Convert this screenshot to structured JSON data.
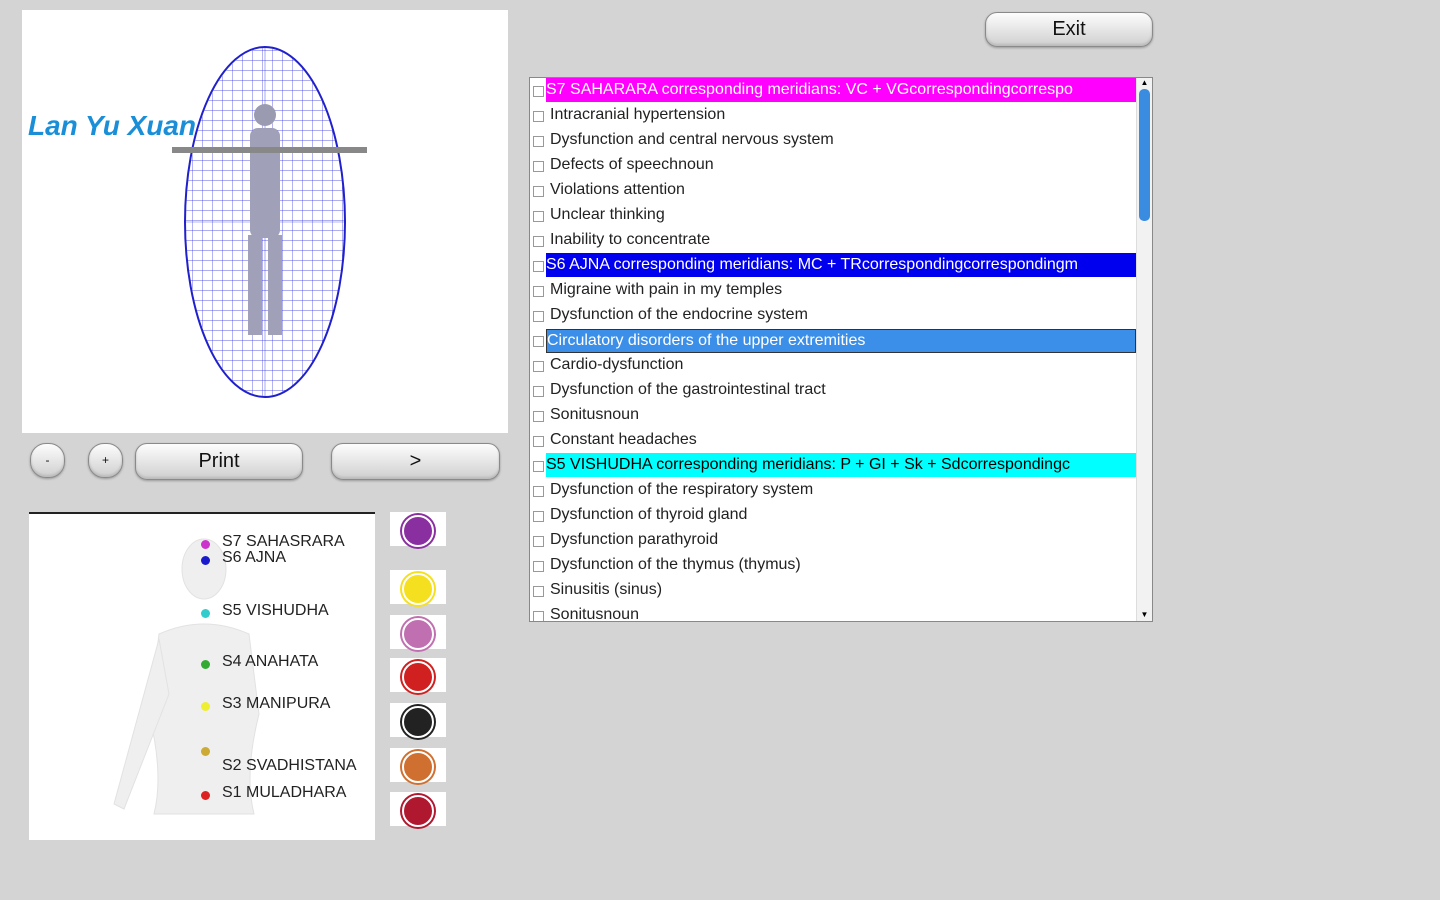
{
  "viewer": {
    "logo": "Lan Yu Xuan"
  },
  "buttons": {
    "zoom_out": "-",
    "zoom_in": "+",
    "print": "Print",
    "next": ">",
    "exit": "Exit"
  },
  "list": {
    "items": [
      {
        "label": "S7 SAHARARA corresponding meridians: VC + VGcorrespondingcorrespo",
        "type": "header",
        "color": "#ff00ff",
        "text_color": "#ffffff"
      },
      {
        "label": "Intracranial hypertension"
      },
      {
        "label": "Dysfunction and central nervous system"
      },
      {
        "label": "Defects of speechnoun"
      },
      {
        "label": "Violations attention"
      },
      {
        "label": "Unclear thinking"
      },
      {
        "label": "Inability to concentrate"
      },
      {
        "label": "S6 AJNA corresponding meridians: MC + TRcorrespondingcorrespondingm",
        "type": "header",
        "color": "#0000ee",
        "text_color": "#ffffff"
      },
      {
        "label": "Migraine with pain in my temples"
      },
      {
        "label": "Dysfunction of the endocrine system"
      },
      {
        "label": "Circulatory disorders of the upper extremities",
        "type": "selected"
      },
      {
        "label": "Cardio-dysfunction"
      },
      {
        "label": "Dysfunction of the gastrointestinal tract"
      },
      {
        "label": "Sonitusnoun"
      },
      {
        "label": "Constant headaches"
      },
      {
        "label": "S5 VISHUDHA corresponding meridians: P + GI + Sk + Sdcorrespondingc",
        "type": "header",
        "color": "#00ffff",
        "text_color": "#000000"
      },
      {
        "label": "Dysfunction of the respiratory system"
      },
      {
        "label": "Dysfunction of thyroid gland"
      },
      {
        "label": "Dysfunction parathyroid"
      },
      {
        "label": "Dysfunction of the thymus (thymus)"
      },
      {
        "label": "Sinusitis (sinus)"
      },
      {
        "label": "Sonitusnoun"
      }
    ]
  },
  "chakras": [
    {
      "label": "S7 SAHASRARA",
      "color": "#cc33cc"
    },
    {
      "label": "S6 AJNA",
      "color": "#1a1acc"
    },
    {
      "label": "S5 VISHUDHA",
      "color": "#33cccc"
    },
    {
      "label": "S4 ANAHATA",
      "color": "#33aa33"
    },
    {
      "label": "S3 MANIPURA",
      "color": "#eeee33"
    },
    {
      "label": "S2 SVADHISTANA",
      "color": "#ccaa33"
    },
    {
      "label": "S1 MULADHARA",
      "color": "#dd2222"
    }
  ],
  "chakra_icons": [
    {
      "name": "sahasrara",
      "color": "#8a2fa0"
    },
    {
      "name": "vishuddha",
      "color": "#f5e020"
    },
    {
      "name": "anahata",
      "color": "#c070b0"
    },
    {
      "name": "manipura",
      "color": "#d02020"
    },
    {
      "name": "svadhisthana",
      "color": "#222222"
    },
    {
      "name": "ajna",
      "color": "#d07030"
    },
    {
      "name": "muladhara",
      "color": "#b01830"
    }
  ]
}
